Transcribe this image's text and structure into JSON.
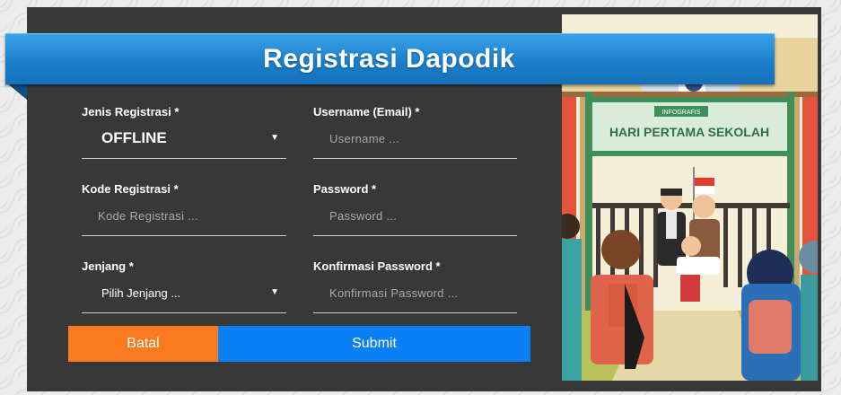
{
  "header": {
    "title": "Registrasi Dapodik"
  },
  "form": {
    "jenis_registrasi": {
      "label": "Jenis Registrasi *",
      "value": "OFFLINE"
    },
    "username": {
      "label": "Username (Email) *",
      "placeholder": "Username ..."
    },
    "kode_registrasi": {
      "label": "Kode Registrasi *",
      "placeholder": "Kode Registrasi ..."
    },
    "password": {
      "label": "Password *",
      "placeholder": "Password ..."
    },
    "jenjang": {
      "label": "Jenjang *",
      "value": "Pilih Jenjang ..."
    },
    "konfirmasi_password": {
      "label": "Konfirmasi Password *",
      "placeholder": "Konfirmasi Password ..."
    },
    "cancel_label": "Batal",
    "submit_label": "Submit"
  },
  "illustration": {
    "banner_small": "INFOGRAFIS",
    "banner_text": "HARI PERTAMA SEKOLAH"
  },
  "colors": {
    "ribbon": "#1b7fcc",
    "panel": "#383838",
    "cancel": "#fc7a1e",
    "submit": "#0a80f5"
  }
}
